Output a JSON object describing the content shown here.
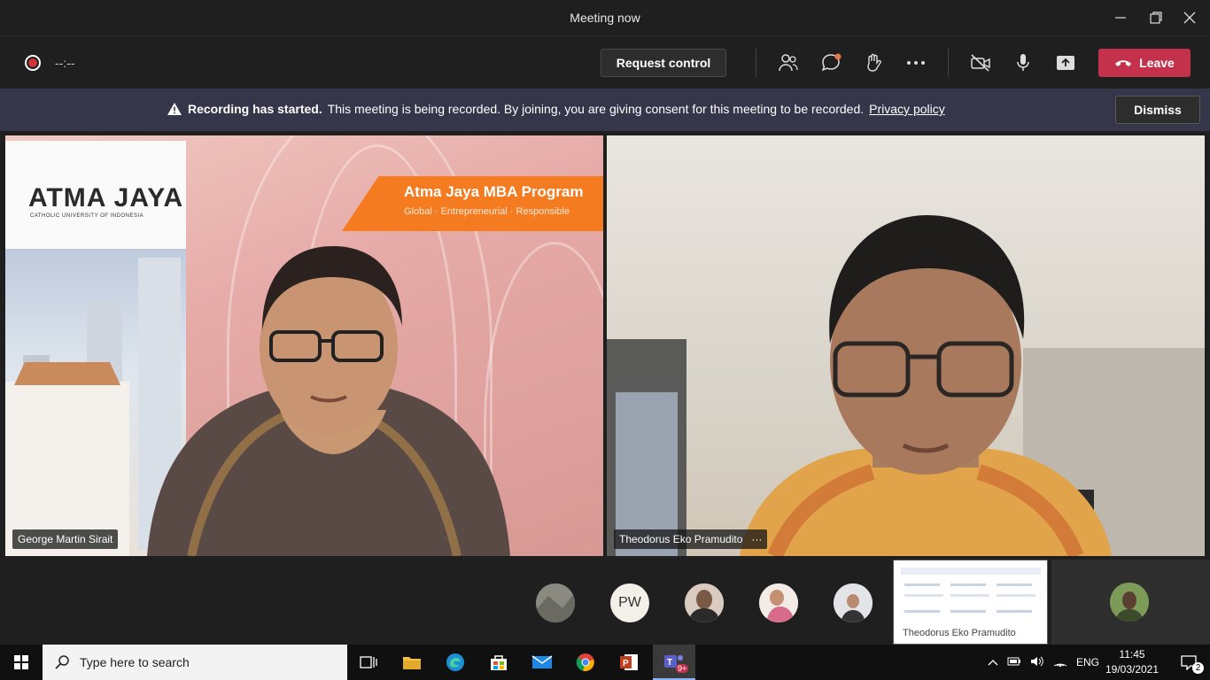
{
  "window": {
    "title": "Meeting now"
  },
  "toolbar": {
    "timer": "--:--",
    "request_control": "Request control",
    "leave": "Leave"
  },
  "banner": {
    "bold_text": "Recording has started.",
    "text": "This meeting is being recorded. By joining, you are giving consent for this meeting to be recorded.",
    "link": "Privacy policy",
    "dismiss": "Dismiss"
  },
  "tiles": {
    "left": {
      "name": "George Martin Sirait",
      "poster_brand": "ATMA JAYA",
      "poster_sub": "CATHOLIC UNIVERSITY OF INDONESIA",
      "banner_title": "Atma Jaya MBA Program",
      "banner_sub": "Global · Entrepreneurial · Responsible"
    },
    "right": {
      "name": "Theodorus Eko Pramudito",
      "more": "···"
    }
  },
  "participants": [
    {
      "initials": "",
      "color": "#8a8a80"
    },
    {
      "initials": "PW",
      "color": "#f3efe9"
    },
    {
      "initials": "",
      "color": "#7b5a45"
    },
    {
      "initials": "",
      "color": "#d8b5a6"
    },
    {
      "initials": "",
      "color": "#bfc2cc"
    }
  ],
  "share_thumb": {
    "label": "Theodorus Eko Pramudito"
  },
  "taskbar": {
    "search_placeholder": "Type here to search",
    "teams_badge": "9+",
    "lang": "ENG",
    "time": "11:45",
    "date": "19/03/2021",
    "notifications": "2"
  }
}
